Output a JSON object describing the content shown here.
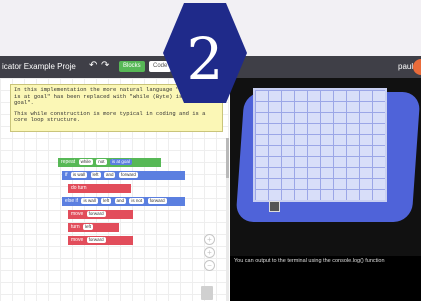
{
  "app": {
    "title": "icator Example Proje",
    "user": "paul",
    "view_blocks_label": "Blocks",
    "view_code_label": "Code"
  },
  "badge": {
    "number": "2"
  },
  "note": {
    "line1": "In this implementation the more natural language \"until (Byte) is at goal\" has been replaced with \"while (Byte) is not at goal\".",
    "line2": "This while construction is more typical in coding and is a core loop structure."
  },
  "blocks": {
    "repeat": "repeat",
    "while": "while",
    "not": "not",
    "is_at_goal": "is at goal",
    "if": "if",
    "do": "do",
    "else_if": "else if",
    "is_wall": "is wall",
    "left": "left",
    "and": "and",
    "is_not": "is not",
    "forward": "forward",
    "turn": "turn",
    "move": "move"
  },
  "console": {
    "text": "You can output to the terminal using the console.log() function"
  },
  "colors": {
    "note_bg": "#fbf7b6",
    "loop": "#57b856",
    "logic": "#5b7fe0",
    "action": "#e24d5b",
    "platform": "#4f63d9"
  }
}
